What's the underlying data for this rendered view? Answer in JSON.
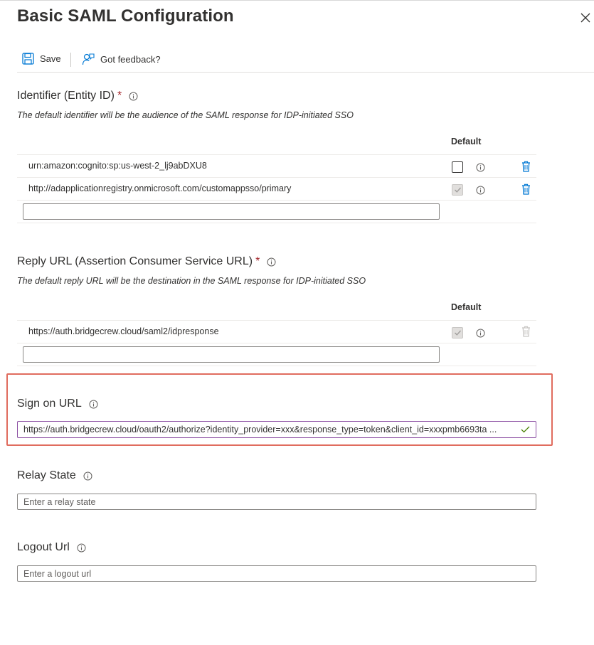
{
  "panel": {
    "title": "Basic SAML Configuration"
  },
  "toolbar": {
    "save_label": "Save",
    "feedback_label": "Got feedback?"
  },
  "identifier": {
    "heading": "Identifier (Entity ID)",
    "required_mark": "*",
    "description": "The default identifier will be the audience of the SAML response for IDP-initiated SSO",
    "default_header": "Default",
    "rows": [
      {
        "value": "urn:amazon:cognito:sp:us-west-2_lj9abDXU8",
        "default": false
      },
      {
        "value": "http://adapplicationregistry.onmicrosoft.com/customappsso/primary",
        "default": true
      }
    ],
    "new_value": ""
  },
  "reply_url": {
    "heading": "Reply URL (Assertion Consumer Service URL)",
    "required_mark": "*",
    "description": "The default reply URL will be the destination in the SAML response for IDP-initiated SSO",
    "default_header": "Default",
    "rows": [
      {
        "value": "https://auth.bridgecrew.cloud/saml2/idpresponse",
        "default": true
      }
    ],
    "new_value": ""
  },
  "sign_on_url": {
    "heading": "Sign on URL",
    "value": "https://auth.bridgecrew.cloud/oauth2/authorize?identity_provider=xxx&response_type=token&client_id=xxxpmb6693ta ..."
  },
  "relay_state": {
    "heading": "Relay State",
    "placeholder": "Enter a relay state"
  },
  "logout_url": {
    "heading": "Logout Url",
    "placeholder": "Enter a logout url"
  },
  "colors": {
    "required": "#a4262c",
    "accent": "#0078d4",
    "highlight_border": "#e06c5e",
    "focus_border": "#8c4fa3"
  }
}
